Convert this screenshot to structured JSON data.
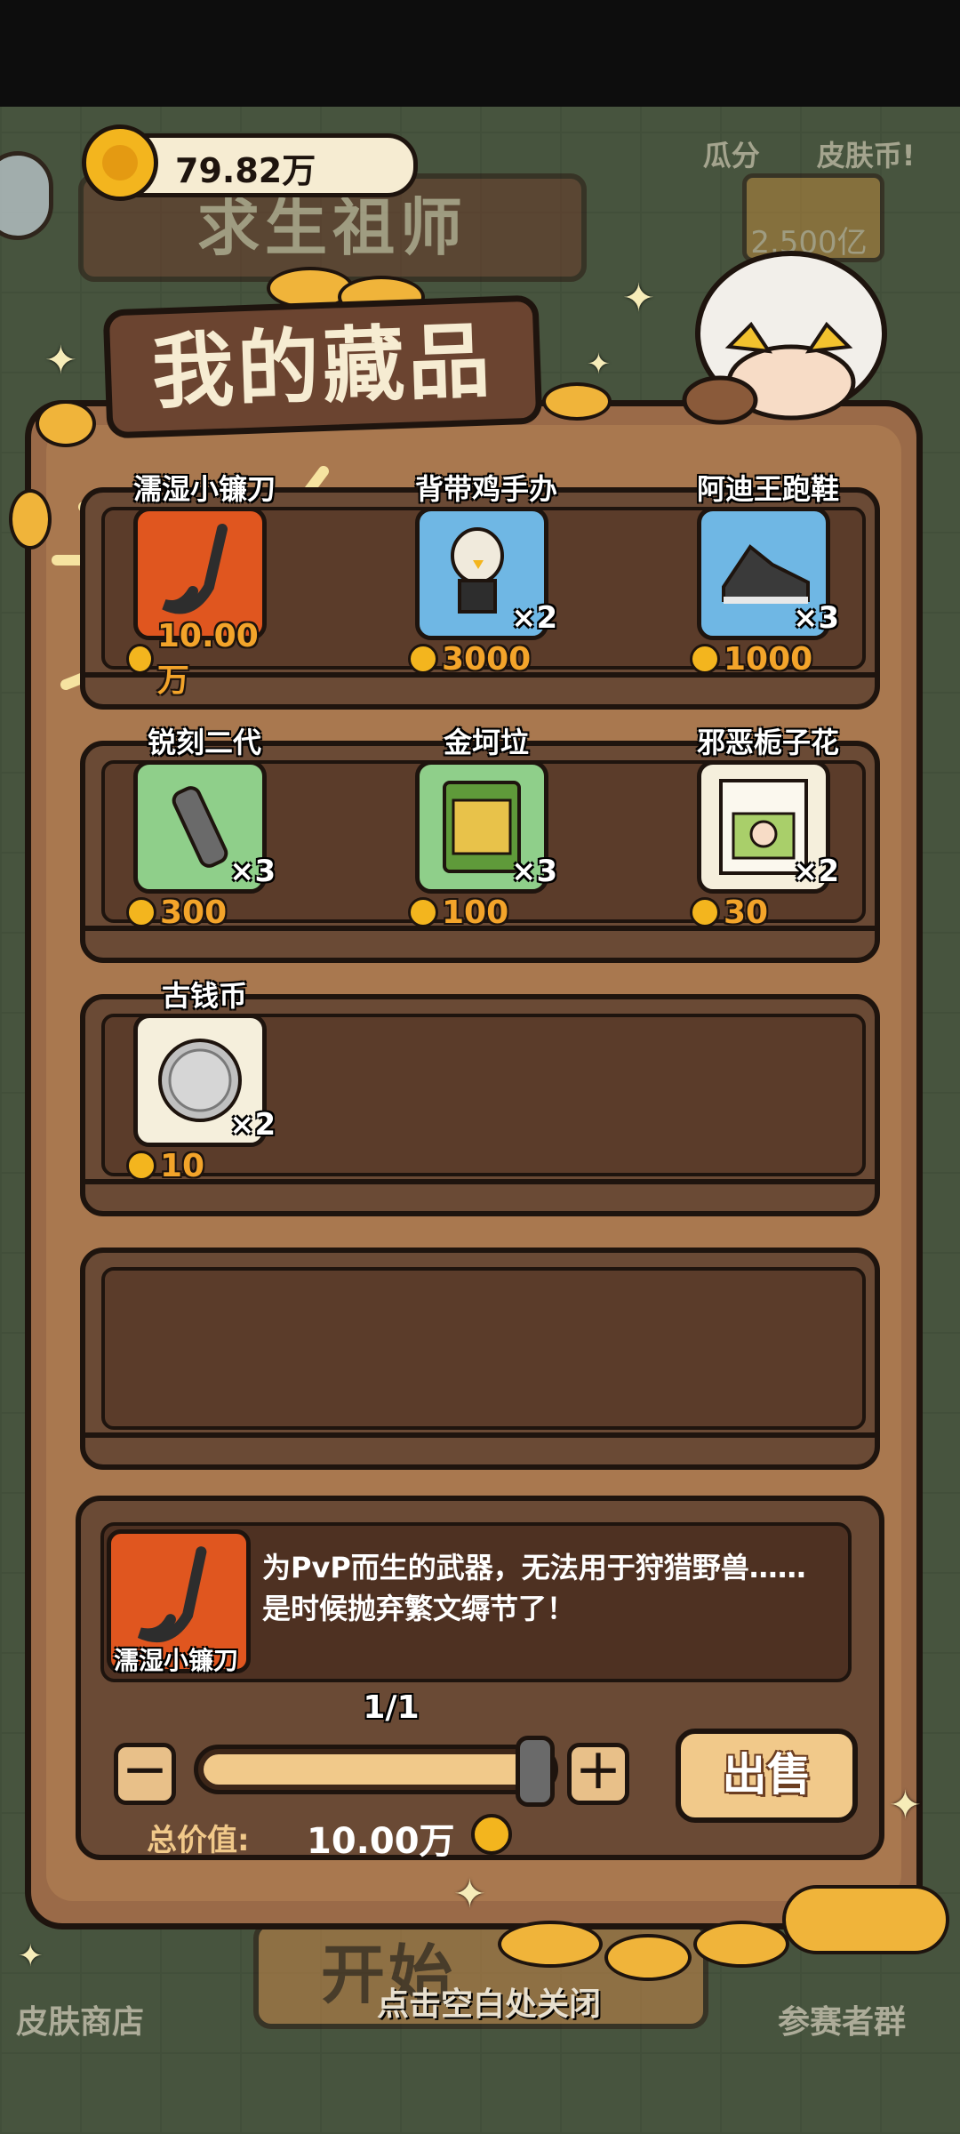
{
  "coins": {
    "amount": "79.82万"
  },
  "background": {
    "title": "求生祖师",
    "prize_label": "瓜分　　皮肤币!",
    "prize_amount": "2.500亿",
    "start_button": "开始",
    "shop": "皮肤商店",
    "group": "参赛者群"
  },
  "panel": {
    "title": "我的藏品"
  },
  "items": [
    {
      "name": "濡湿小镰刀",
      "count": "",
      "price": "10.00万",
      "icon": "sickle-icon",
      "bg": "#e0561f"
    },
    {
      "name": "背带鸡手办",
      "count": "×2",
      "price": "3000",
      "icon": "chicken-figure-icon",
      "bg": "#6fb7e4"
    },
    {
      "name": "阿迪王跑鞋",
      "count": "×3",
      "price": "1000",
      "icon": "sneaker-icon",
      "bg": "#6fb7e4"
    },
    {
      "name": "锐刻二代",
      "count": "×3",
      "price": "300",
      "icon": "vape-icon",
      "bg": "#8fcf8a"
    },
    {
      "name": "金坷垃",
      "count": "×3",
      "price": "100",
      "icon": "fertilizer-bag-icon",
      "bg": "#8fcf8a"
    },
    {
      "name": "邪恶栀子花",
      "count": "×2",
      "price": "30",
      "icon": "book-icon",
      "bg": "#f5efdc"
    },
    {
      "name": "古钱币",
      "count": "×2",
      "price": "10",
      "icon": "old-coin-icon",
      "bg": "#f5efdc"
    }
  ],
  "detail": {
    "name": "濡湿小镰刀",
    "description": "为PvP而生的武器，无法用于狩猎野兽……是时候抛弃繁文缛节了！",
    "pager": "1/1",
    "minus": "－",
    "plus": "＋",
    "sell_label": "出售",
    "total_label": "总价值:",
    "total_value": "10.00万",
    "quantity_fraction": 1.0
  },
  "close_hint": "点击空白处关闭",
  "colors": {
    "panel": "#9a6a48",
    "shelf": "#6a4a35",
    "accent": "#f3a42a"
  }
}
